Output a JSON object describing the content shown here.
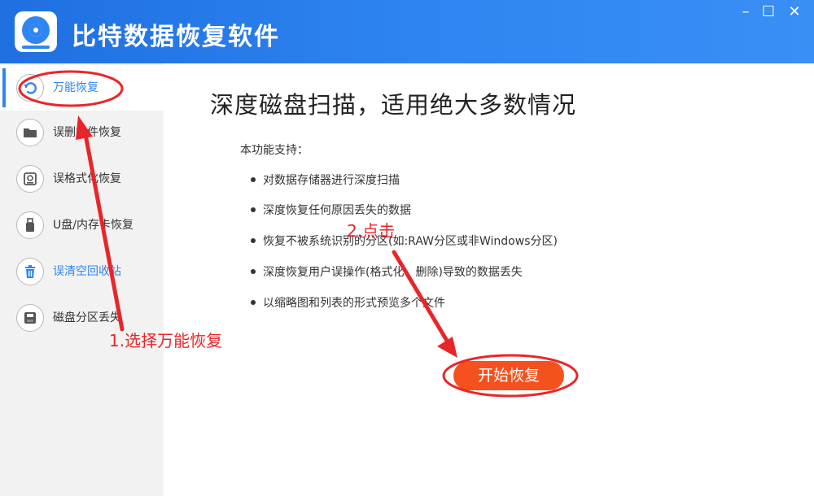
{
  "app": {
    "title": "比特数据恢复软件",
    "window_controls": {
      "minimize": "–",
      "maximize": "☐",
      "close": "✕"
    }
  },
  "sidebar": {
    "items": [
      {
        "label": "万能恢复",
        "icon": "undo-icon",
        "active": true
      },
      {
        "label": "误删文件恢复",
        "icon": "folder-icon",
        "active": false
      },
      {
        "label": "误格式化恢复",
        "icon": "disk-format-icon",
        "active": false
      },
      {
        "label": "U盘/内存卡恢复",
        "icon": "usb-icon",
        "active": false
      },
      {
        "label": "误清空回收站",
        "icon": "trash-icon",
        "active": false
      },
      {
        "label": "磁盘分区丢失",
        "icon": "partition-icon",
        "active": false
      }
    ]
  },
  "main": {
    "title": "深度磁盘扫描，适用绝大多数情况",
    "support_intro": "本功能支持：",
    "features": [
      "对数据存储器进行深度扫描",
      "深度恢复任何原因丢失的数据",
      "恢复不被系统识别的分区(如:RAW分区或非Windows分区)",
      "深度恢复用户误操作(格式化、删除)导致的数据丢失",
      "以缩略图和列表的形式预览多个文件"
    ],
    "start_button": "开始恢复"
  },
  "annotations": {
    "step1": "1.选择万能恢复",
    "step2": "2.点击",
    "color": "#e8262a"
  },
  "colors": {
    "titlebar": "#2f86f2",
    "accent": "#2f86f2",
    "button": "#f4511e",
    "sidebar_bg": "#f2f2f2"
  }
}
